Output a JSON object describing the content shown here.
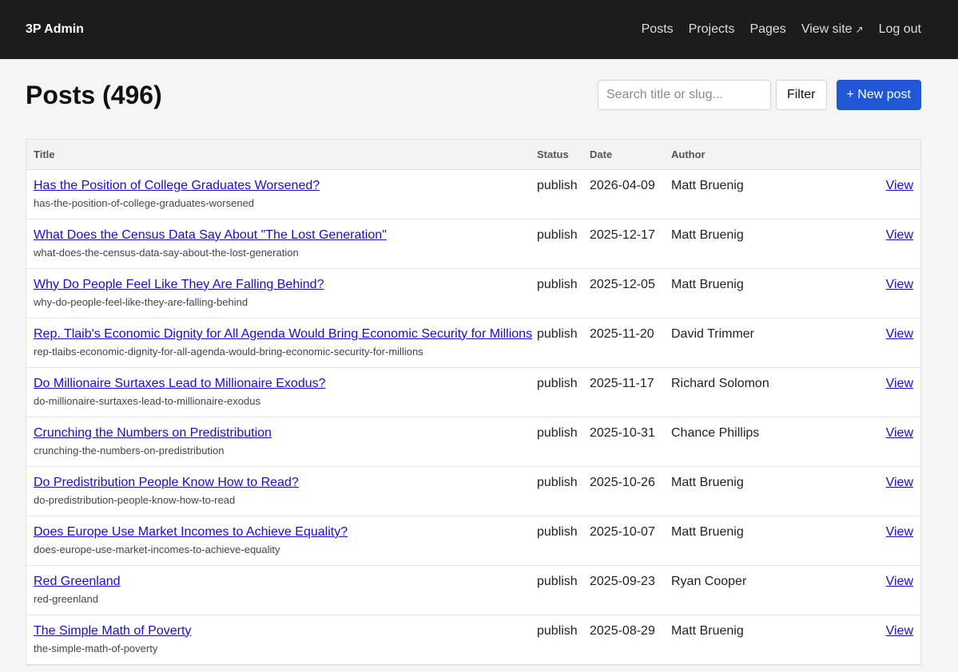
{
  "brand": "3P Admin",
  "nav": {
    "posts": "Posts",
    "projects": "Projects",
    "pages": "Pages",
    "view_site": "View site",
    "view_site_icon": "↗",
    "logout": "Log out"
  },
  "page": {
    "title": "Posts (496)"
  },
  "search": {
    "placeholder": "Search title or slug...",
    "value": ""
  },
  "buttons": {
    "filter": "Filter",
    "new_post": "+ New post"
  },
  "table": {
    "headers": {
      "title": "Title",
      "status": "Status",
      "date": "Date",
      "author": "Author",
      "actions": ""
    },
    "rows": [
      {
        "title": "Has the Position of College Graduates Worsened?",
        "slug": "has-the-position-of-college-graduates-worsened",
        "status": "publish",
        "date": "2026-04-09",
        "author": "Matt Bruenig",
        "view": "View"
      },
      {
        "title": "What Does the Census Data Say About \"The Lost Generation\"",
        "slug": "what-does-the-census-data-say-about-the-lost-generation",
        "status": "publish",
        "date": "2025-12-17",
        "author": "Matt Bruenig",
        "view": "View"
      },
      {
        "title": "Why Do People Feel Like They Are Falling Behind?",
        "slug": "why-do-people-feel-like-they-are-falling-behind",
        "status": "publish",
        "date": "2025-12-05",
        "author": "Matt Bruenig",
        "view": "View"
      },
      {
        "title": "Rep. Tlaib's Economic Dignity for All Agenda Would Bring Economic Security for Millions",
        "slug": "rep-tlaibs-economic-dignity-for-all-agenda-would-bring-economic-security-for-millions",
        "status": "publish",
        "date": "2025-11-20",
        "author": "David Trimmer",
        "view": "View"
      },
      {
        "title": "Do Millionaire Surtaxes Lead to Millionaire Exodus?",
        "slug": "do-millionaire-surtaxes-lead-to-millionaire-exodus",
        "status": "publish",
        "date": "2025-11-17",
        "author": "Richard Solomon",
        "view": "View"
      },
      {
        "title": "Crunching the Numbers on Predistribution",
        "slug": "crunching-the-numbers-on-predistribution",
        "status": "publish",
        "date": "2025-10-31",
        "author": "Chance Phillips",
        "view": "View"
      },
      {
        "title": "Do Predistribution People Know How to Read?",
        "slug": "do-predistribution-people-know-how-to-read",
        "status": "publish",
        "date": "2025-10-26",
        "author": "Matt Bruenig",
        "view": "View"
      },
      {
        "title": "Does Europe Use Market Incomes to Achieve Equality?",
        "slug": "does-europe-use-market-incomes-to-achieve-equality",
        "status": "publish",
        "date": "2025-10-07",
        "author": "Matt Bruenig",
        "view": "View"
      },
      {
        "title": "Red Greenland",
        "slug": "red-greenland",
        "status": "publish",
        "date": "2025-09-23",
        "author": "Ryan Cooper",
        "view": "View"
      },
      {
        "title": "The Simple Math of Poverty",
        "slug": "the-simple-math-of-poverty",
        "status": "publish",
        "date": "2025-08-29",
        "author": "Matt Bruenig",
        "view": "View"
      }
    ]
  },
  "colors": {
    "topbar_bg": "#1c1c1c",
    "page_bg": "#f5f5f5",
    "link": "#1a0dcc",
    "primary_button": "#1f57d6"
  }
}
